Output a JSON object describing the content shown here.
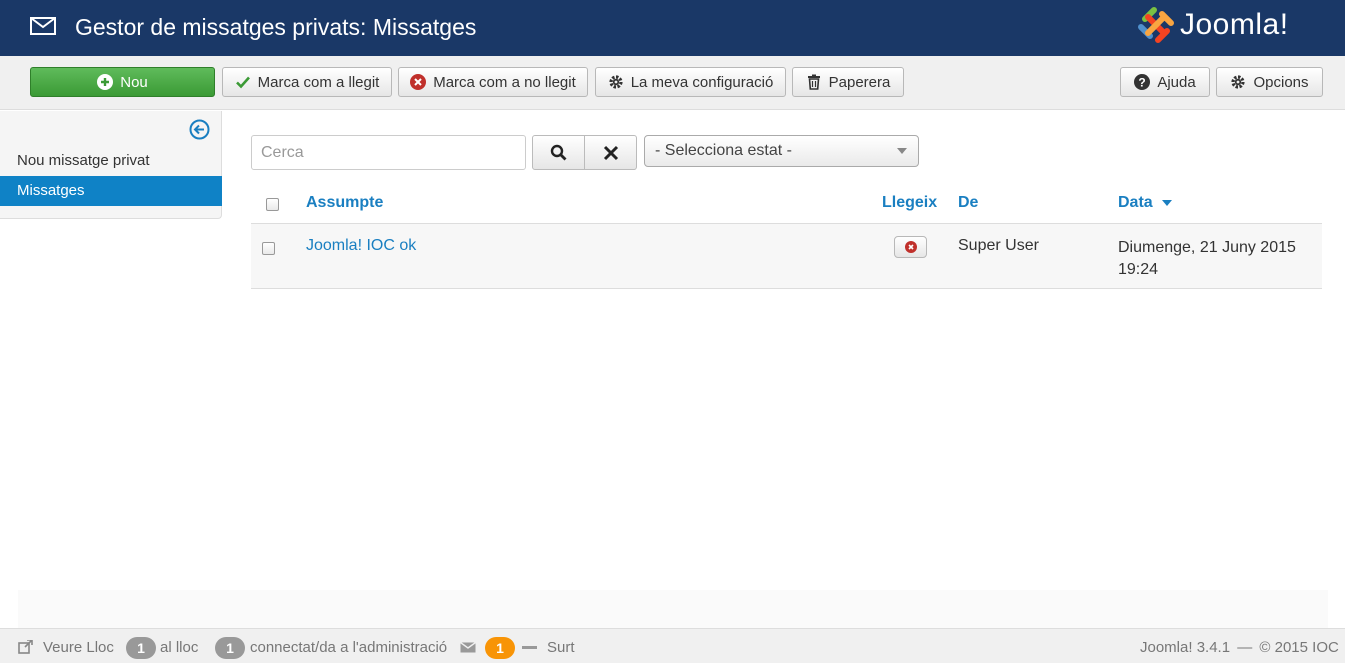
{
  "header": {
    "title": "Gestor de missatges privats: Missatges",
    "logo_text": "Joomla!"
  },
  "toolbar": {
    "new_label": "Nou",
    "mark_read_label": "Marca com a llegit",
    "mark_unread_label": "Marca com a no llegit",
    "my_settings_label": "La meva configuració",
    "trash_label": "Paperera",
    "help_label": "Ajuda",
    "options_label": "Opcions"
  },
  "sidebar": {
    "items": [
      {
        "label": "Nou missatge privat",
        "active": false
      },
      {
        "label": "Missatges",
        "active": true
      }
    ]
  },
  "filters": {
    "search_placeholder": "Cerca",
    "status_selected": "- Selecciona estat -"
  },
  "table": {
    "columns": {
      "subject": "Assumpte",
      "read": "Llegeix",
      "from": "De",
      "date": "Data"
    },
    "rows": [
      {
        "subject": "Joomla! IOC ok",
        "read": "no",
        "from": "Super User",
        "date_line1": "Diumenge, 21 Juny 2015",
        "date_line2": "19:24"
      }
    ]
  },
  "status_bar": {
    "view_site": "Veure Lloc",
    "visitors_count": "1",
    "visitors_label": "al lloc",
    "admins_count": "1",
    "admins_label": "connectat/da a l'administració",
    "messages_count": "1",
    "logout": "Surt",
    "version": "Joomla! 3.4.1",
    "separator": "—",
    "copyright": "© 2015 IOC"
  },
  "colors": {
    "header_bg": "#1a3867",
    "accent_blue": "#1a7fc1",
    "active_sidebar": "#0f82c6",
    "new_button_green": "#4aa844",
    "unread_red": "#c0302b",
    "badge_orange": "#f89406"
  }
}
